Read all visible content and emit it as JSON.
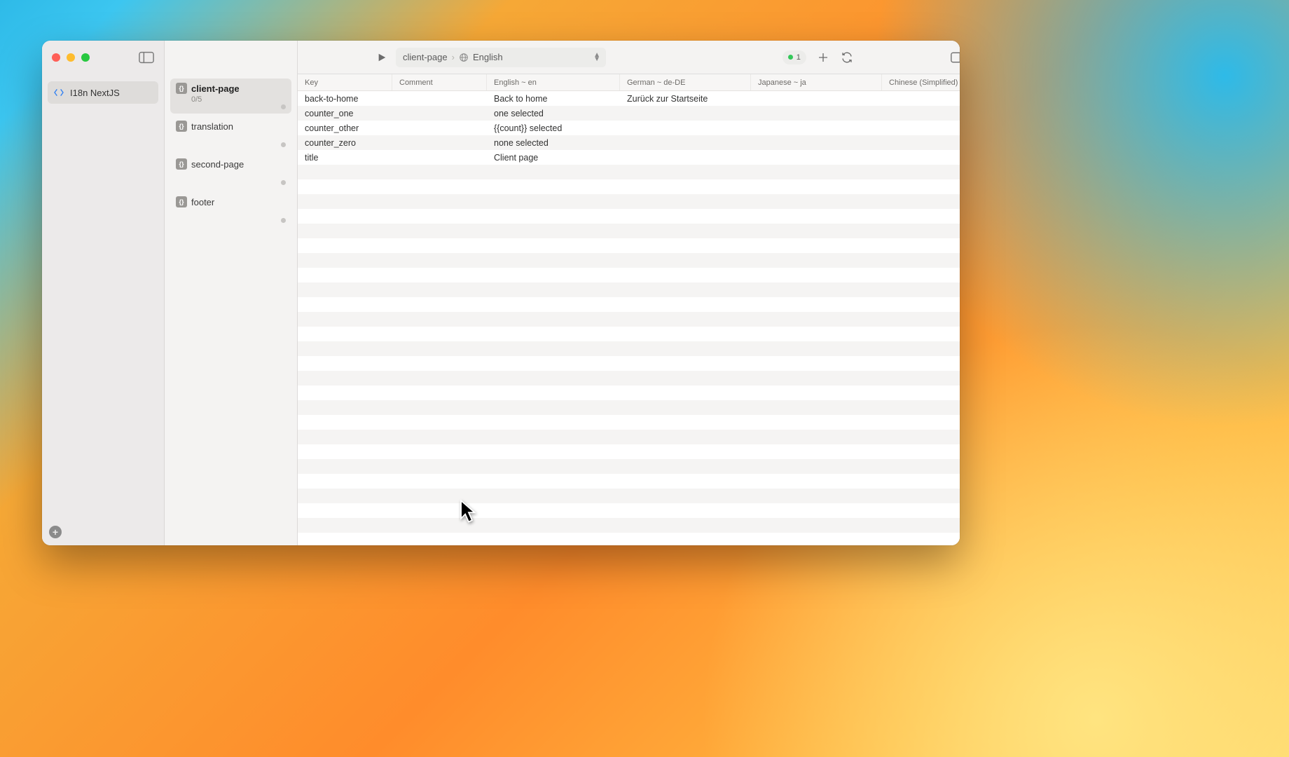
{
  "project": {
    "name": "I18n NextJS"
  },
  "files": [
    {
      "name": "client-page",
      "sub": "0/5",
      "active": true
    },
    {
      "name": "translation",
      "sub": "",
      "active": false
    },
    {
      "name": "second-page",
      "sub": "",
      "active": false
    },
    {
      "name": "footer",
      "sub": "",
      "active": false
    }
  ],
  "breadcrumb": {
    "file": "client-page",
    "lang": "English"
  },
  "badge": {
    "count": "1"
  },
  "columns": {
    "key": "Key",
    "comment": "Comment",
    "en": "English ~ en",
    "de": "German ~ de-DE",
    "ja": "Japanese ~ ja",
    "zh": "Chinese (Simplified) ~"
  },
  "rows": [
    {
      "key": "back-to-home",
      "comment": "",
      "en": "Back to home",
      "de": "Zurück zur Startseite",
      "ja": "",
      "zh": ""
    },
    {
      "key": "counter_one",
      "comment": "",
      "en": "one selected",
      "de": "",
      "ja": "",
      "zh": ""
    },
    {
      "key": "counter_other",
      "comment": "",
      "en": "{{count}} selected",
      "de": "",
      "ja": "",
      "zh": ""
    },
    {
      "key": "counter_zero",
      "comment": "",
      "en": "none selected",
      "de": "",
      "ja": "",
      "zh": ""
    },
    {
      "key": "title",
      "comment": "",
      "en": "Client page",
      "de": "",
      "ja": "",
      "zh": ""
    }
  ]
}
